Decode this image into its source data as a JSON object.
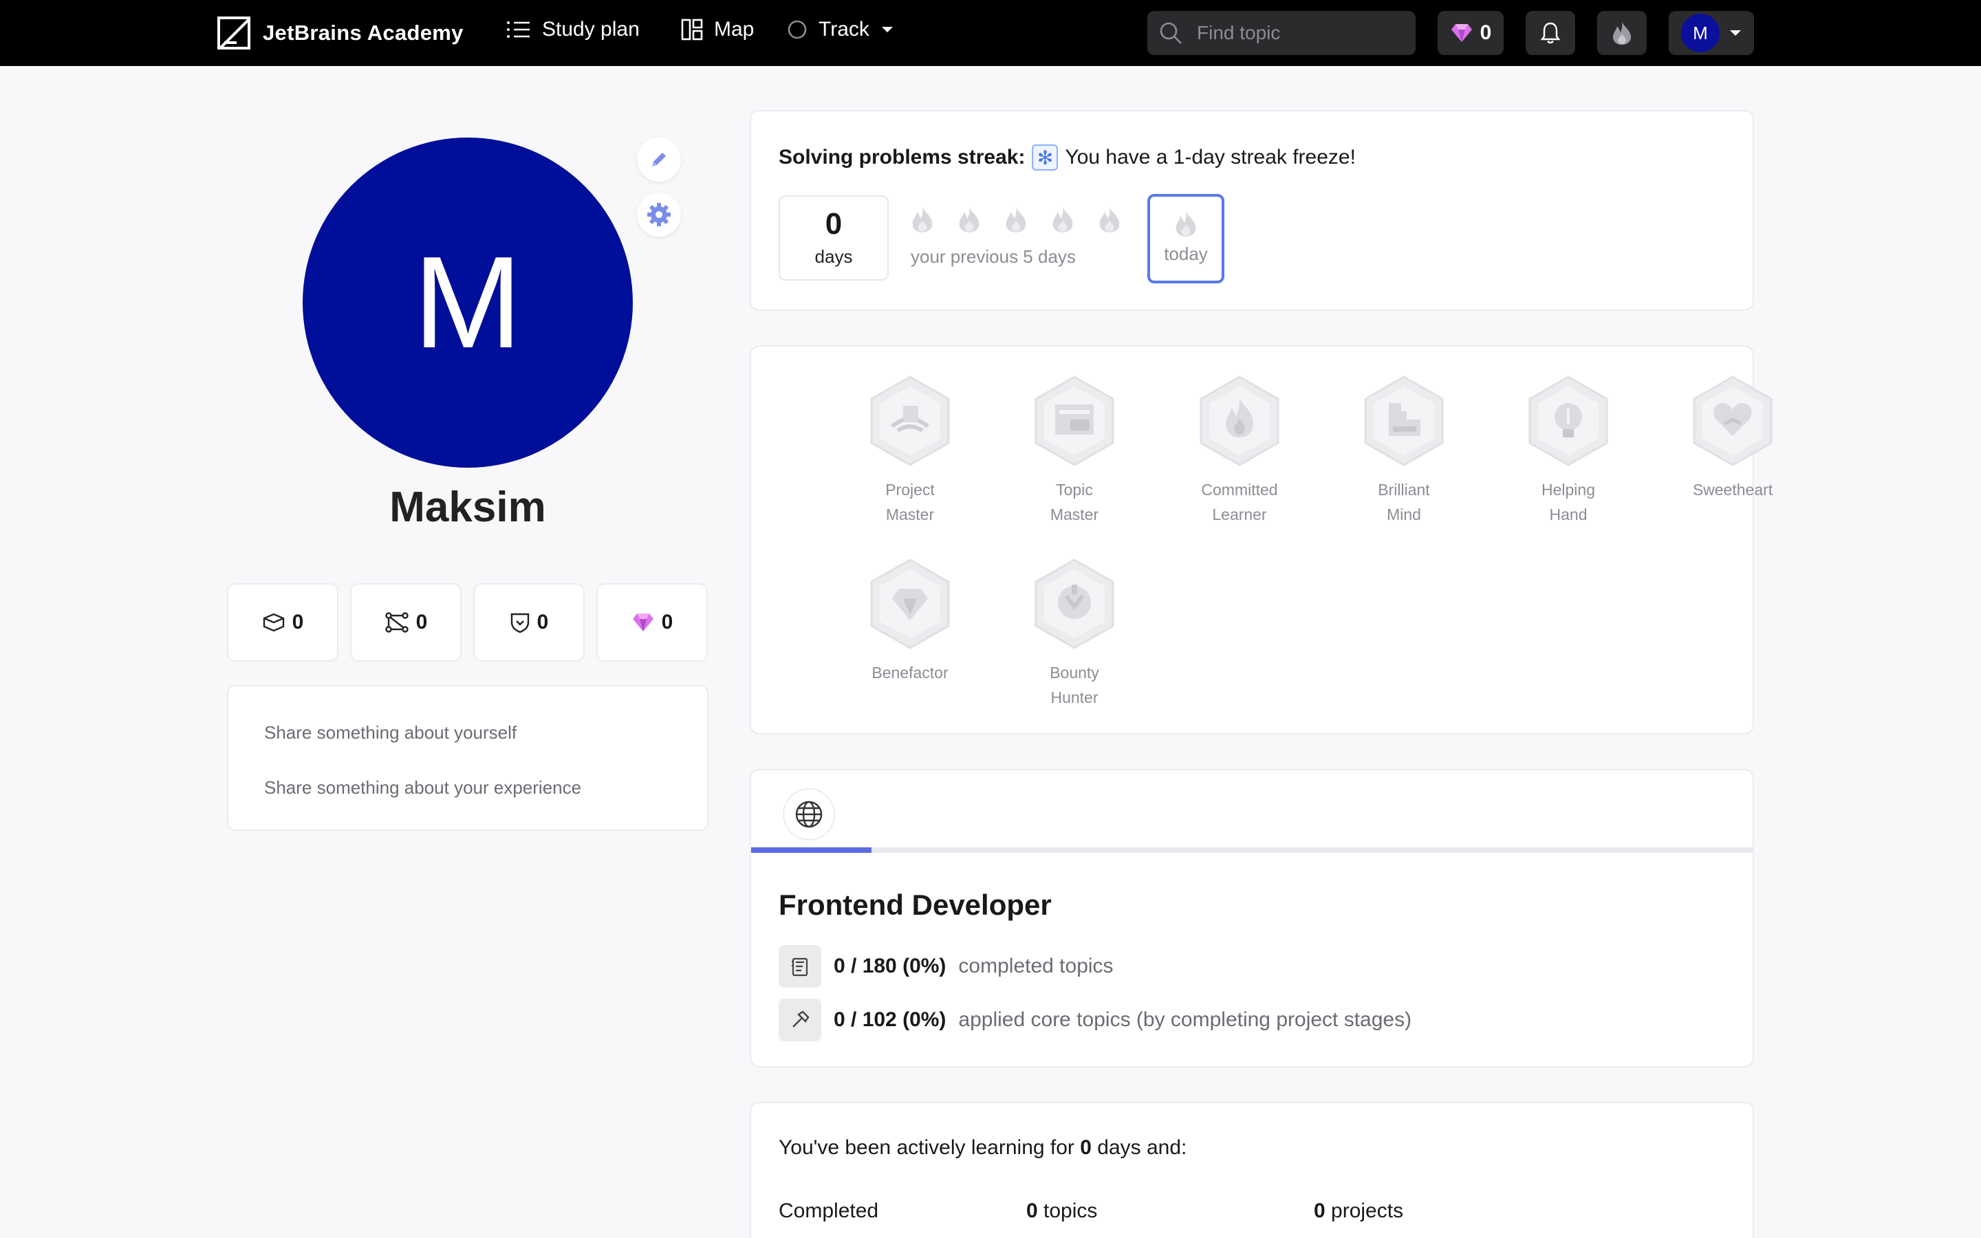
{
  "header": {
    "logo_text": "JetBrains Academy",
    "nav": {
      "study_plan": "Study plan",
      "map": "Map",
      "track": "Track"
    },
    "search": {
      "placeholder": "Find topic"
    },
    "gems_count": "0",
    "avatar_letter": "M"
  },
  "profile": {
    "avatar_letter": "M",
    "name": "Maksim",
    "stats": {
      "projects": "0",
      "topics": "0",
      "badges": "0",
      "gems": "0"
    },
    "about": {
      "yourself_placeholder": "Share something about yourself",
      "experience_placeholder": "Share something about your experience"
    }
  },
  "streak": {
    "title": "Solving problems streak:",
    "freeze_text": "You have a 1-day streak freeze!",
    "days_value": "0",
    "days_label": "days",
    "previous_label": "your previous 5 days",
    "today_label": "today"
  },
  "badges": [
    {
      "label_line1": "Project",
      "label_line2": "Master",
      "icon": "project-master-badge-icon"
    },
    {
      "label_line1": "Topic",
      "label_line2": "Master",
      "icon": "topic-master-badge-icon"
    },
    {
      "label_line1": "Committed",
      "label_line2": "Learner",
      "icon": "committed-learner-badge-icon"
    },
    {
      "label_line1": "Brilliant",
      "label_line2": "Mind",
      "icon": "brilliant-mind-badge-icon"
    },
    {
      "label_line1": "Helping",
      "label_line2": "Hand",
      "icon": "helping-hand-badge-icon"
    },
    {
      "label_line1": "Sweetheart",
      "label_line2": "",
      "icon": "sweetheart-badge-icon"
    },
    {
      "label_line1": "Benefactor",
      "label_line2": "",
      "icon": "benefactor-badge-icon"
    },
    {
      "label_line1": "Bounty",
      "label_line2": "Hunter",
      "icon": "bounty-hunter-badge-icon"
    }
  ],
  "track": {
    "title": "Frontend Developer",
    "completed_value": "0 / 180 (0%)",
    "completed_text": "completed topics",
    "applied_value": "0 / 102 (0%)",
    "applied_text": "applied core topics (by completing project stages)",
    "progress_fraction": 0.12
  },
  "learning": {
    "prefix": "You've been actively learning for",
    "days": "0",
    "suffix": "days and:",
    "completed_label": "Completed",
    "topics_value": "0",
    "topics_label": "topics",
    "projects_value": "0",
    "projects_label": "projects"
  },
  "colors": {
    "accent": "#5a6be0",
    "avatar": "#000f99",
    "gem": "#e05ad8"
  }
}
